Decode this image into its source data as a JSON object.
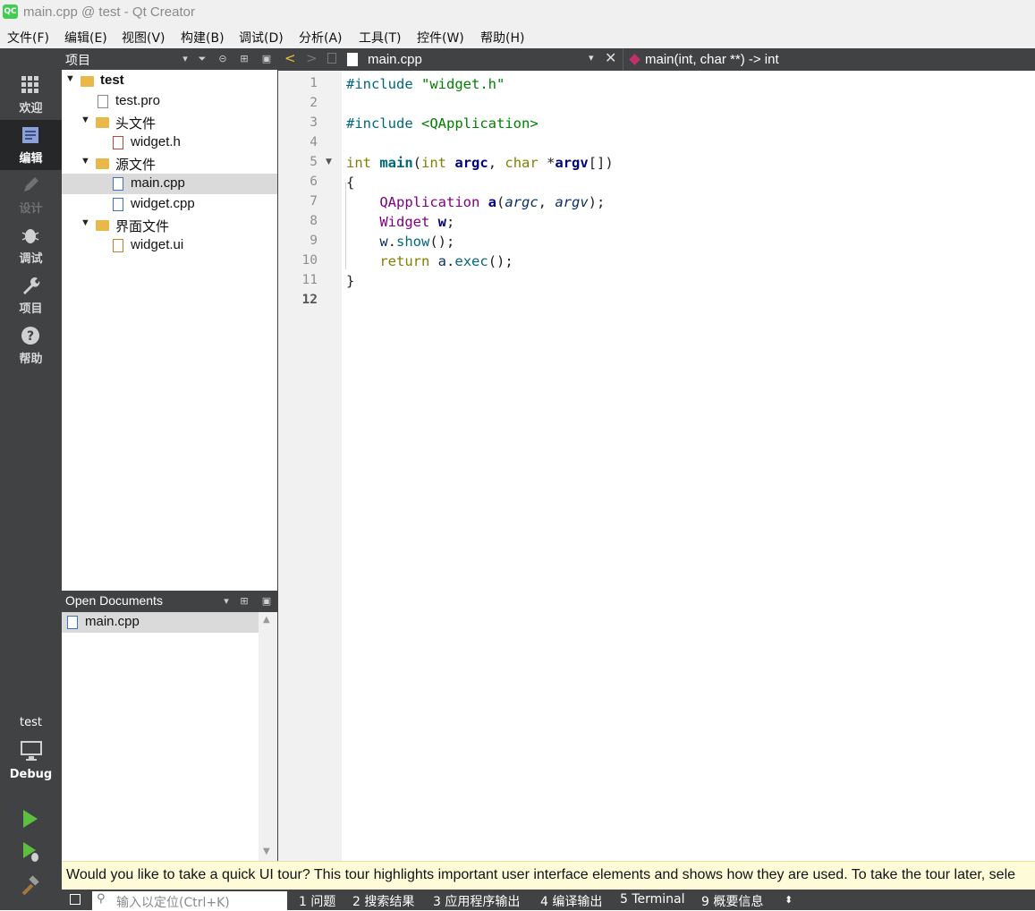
{
  "window": {
    "title": "main.cpp @ test - Qt Creator",
    "logo": "QC"
  },
  "menu": [
    "文件(F)",
    "编辑(E)",
    "视图(V)",
    "构建(B)",
    "调试(D)",
    "分析(A)",
    "工具(T)",
    "控件(W)",
    "帮助(H)"
  ],
  "modes": {
    "welcome": "欢迎",
    "edit": "编辑",
    "design": "设计",
    "debug": "调试",
    "projects": "项目",
    "help": "帮助"
  },
  "kit": {
    "project": "test",
    "config": "Debug"
  },
  "project_panel": {
    "title": "项目",
    "tree": [
      {
        "label": "test",
        "type": "project"
      },
      {
        "label": "test.pro",
        "type": "file"
      },
      {
        "label": "头文件",
        "type": "folder"
      },
      {
        "label": "widget.h",
        "type": "file"
      },
      {
        "label": "源文件",
        "type": "folder"
      },
      {
        "label": "main.cpp",
        "type": "file"
      },
      {
        "label": "widget.cpp",
        "type": "file"
      },
      {
        "label": "界面文件",
        "type": "folder"
      },
      {
        "label": "widget.ui",
        "type": "file"
      }
    ]
  },
  "open_docs": {
    "title": "Open Documents",
    "items": [
      "main.cpp"
    ]
  },
  "editor": {
    "file": "main.cpp",
    "symbol": "main(int, char **) -> int",
    "current_line": 12,
    "line_numbers": [
      "1",
      "2",
      "3",
      "4",
      "5",
      "6",
      "7",
      "8",
      "9",
      "10",
      "11",
      "12"
    ],
    "code": {
      "l1a": "#include",
      "l1b": "\"widget.h\"",
      "l3a": "#include",
      "l3b": "<QApplication>",
      "l5_int": "int",
      "l5_main": "main",
      "l5_paren": "(",
      "l5_int2": "int",
      "l5_argc": "argc",
      "l5_comma": ", ",
      "l5_char": "char",
      "l5_star": " *",
      "l5_argv": "argv",
      "l5_end": "[])",
      "l6": "{",
      "l7_type": "QApplication",
      "l7_a": "a",
      "l7_open": "(",
      "l7_argc": "argc",
      "l7_comma": ", ",
      "l7_argv": "argv",
      "l7_end": ");",
      "l8_type": "Widget",
      "l8_w": "w",
      "l8_end": ";",
      "l9_w": "w",
      "l9_dot": ".",
      "l9_show": "show",
      "l9_end": "();",
      "l10_ret": "return",
      "l10_a": "a",
      "l10_dot": ".",
      "l10_exec": "exec",
      "l10_end": "();",
      "l11": "}"
    }
  },
  "tour_message": "Would you like to take a quick UI tour? This tour highlights important user interface elements and shows how they are used. To take the tour later, sele",
  "locator": {
    "placeholder": "输入以定位(Ctrl+K)"
  },
  "output_tabs": [
    "1 问题",
    "2 搜索结果",
    "3 应用程序输出",
    "4 编译输出",
    "5 Terminal",
    "9 概要信息"
  ]
}
